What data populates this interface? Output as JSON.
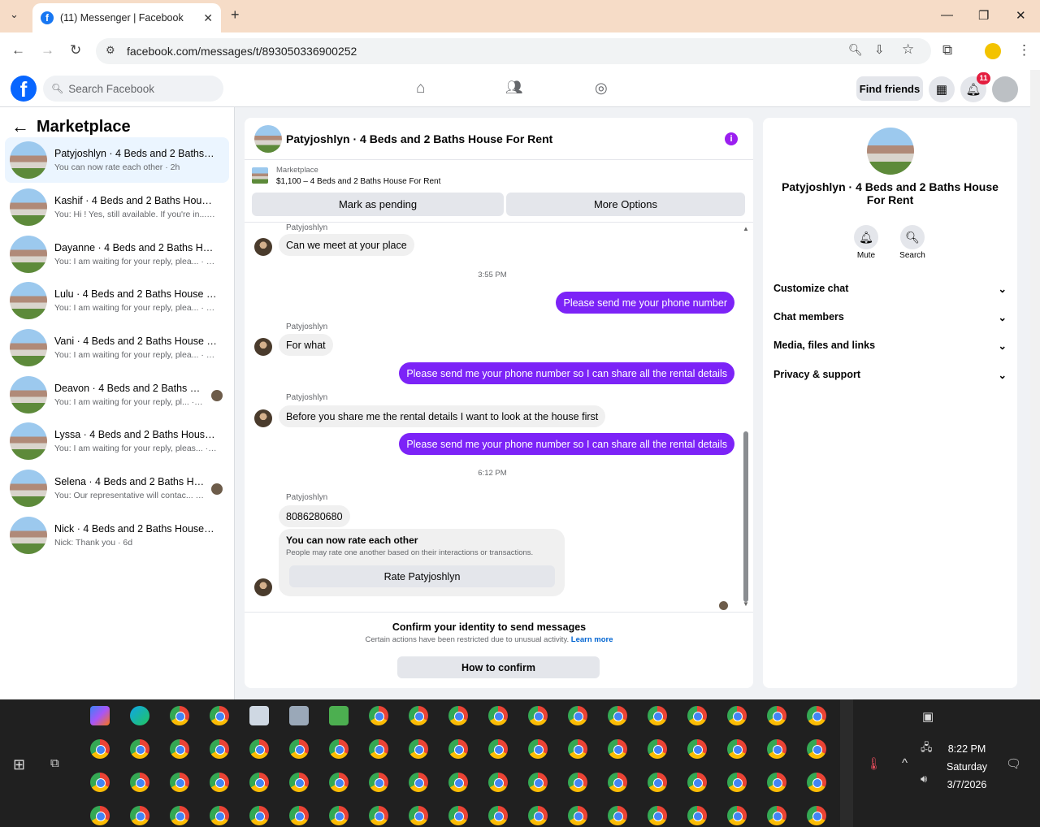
{
  "browser": {
    "tab_title": "(11) Messenger | Facebook",
    "url": "facebook.com/messages/t/893050336900252",
    "new_tab": "+"
  },
  "fb": {
    "search_placeholder": "Search Facebook",
    "find_friends": "Find friends",
    "notification_count": "11"
  },
  "sidebar": {
    "title": "Marketplace",
    "conversations": [
      {
        "name": "Patyjoshlyn · 4 Beds and 2 Baths H...",
        "preview": "You can now rate each other · 2h",
        "active": true
      },
      {
        "name": "Kashif · 4 Beds and 2 Baths House ...",
        "preview": "You: Hi ! Yes, still available. If you're in... · 4h"
      },
      {
        "name": "Dayanne · 4 Beds and 2 Baths Hou...",
        "preview": "You: I am waiting for your reply, plea... · 16h"
      },
      {
        "name": "Lulu · 4 Beds and 2 Baths House F...",
        "preview": "You: I am waiting for your reply, plea... · 20h"
      },
      {
        "name": "Vani · 4 Beds and 2 Baths House F...",
        "preview": "You: I am waiting for your reply, plea... · 20h"
      },
      {
        "name": "Deavon · 4 Beds and 2 Baths Ho...",
        "preview": "You: I am waiting for your reply, pl... · 3d"
      },
      {
        "name": "Lyssa · 4 Beds and 2 Baths House F...",
        "preview": "You: I am waiting for your reply, pleas... · 3d"
      },
      {
        "name": "Selena · 4 Beds and 2 Baths Hou...",
        "preview": "You: Our representative will contac... · 4d"
      },
      {
        "name": "Nick · 4 Beds and 2 Baths House F...",
        "preview": "Nick: Thank you · 6d"
      }
    ]
  },
  "chat": {
    "title": "Patyjoshlyn · 4 Beds and 2 Baths House For Rent",
    "marketplace_label": "Marketplace",
    "listing": "$1,100 – 4 Beds and 2 Baths House For Rent",
    "mark_pending": "Mark as pending",
    "more_options": "More Options",
    "sender": "Patyjoshlyn",
    "messages": {
      "m1": "Can we meet at your place",
      "t1": "3:55 PM",
      "m2": "Please send me your phone number",
      "m3": "For what",
      "m4": "Please send me your phone number so I can share all the rental details",
      "m5": "Before you share me the rental details I want to look at the house first",
      "m6": "Please send me your phone number so I can share all the rental details",
      "t2": "6:12 PM",
      "m7": "8086280680"
    },
    "rate": {
      "title": "You can now rate each other",
      "desc": "People may rate one another based on their interactions or transactions.",
      "button": "Rate Patyjoshlyn"
    },
    "confirm": {
      "title": "Confirm your identity to send messages",
      "desc": "Certain actions have been restricted due to unusual activity.",
      "learn_more": "Learn more",
      "button": "How to confirm"
    }
  },
  "details": {
    "name": "Patyjoshlyn · 4 Beds and 2 Baths House For Rent",
    "mute": "Mute",
    "search": "Search",
    "sections": [
      "Customize chat",
      "Chat members",
      "Media, files and links",
      "Privacy & support"
    ]
  },
  "taskbar": {
    "time": "8:22 PM",
    "day": "Saturday",
    "date": "3/7/2026"
  },
  "colors": {
    "accent": "#7c23f7",
    "fb_blue": "#0866ff",
    "badge": "#e41e3f"
  }
}
